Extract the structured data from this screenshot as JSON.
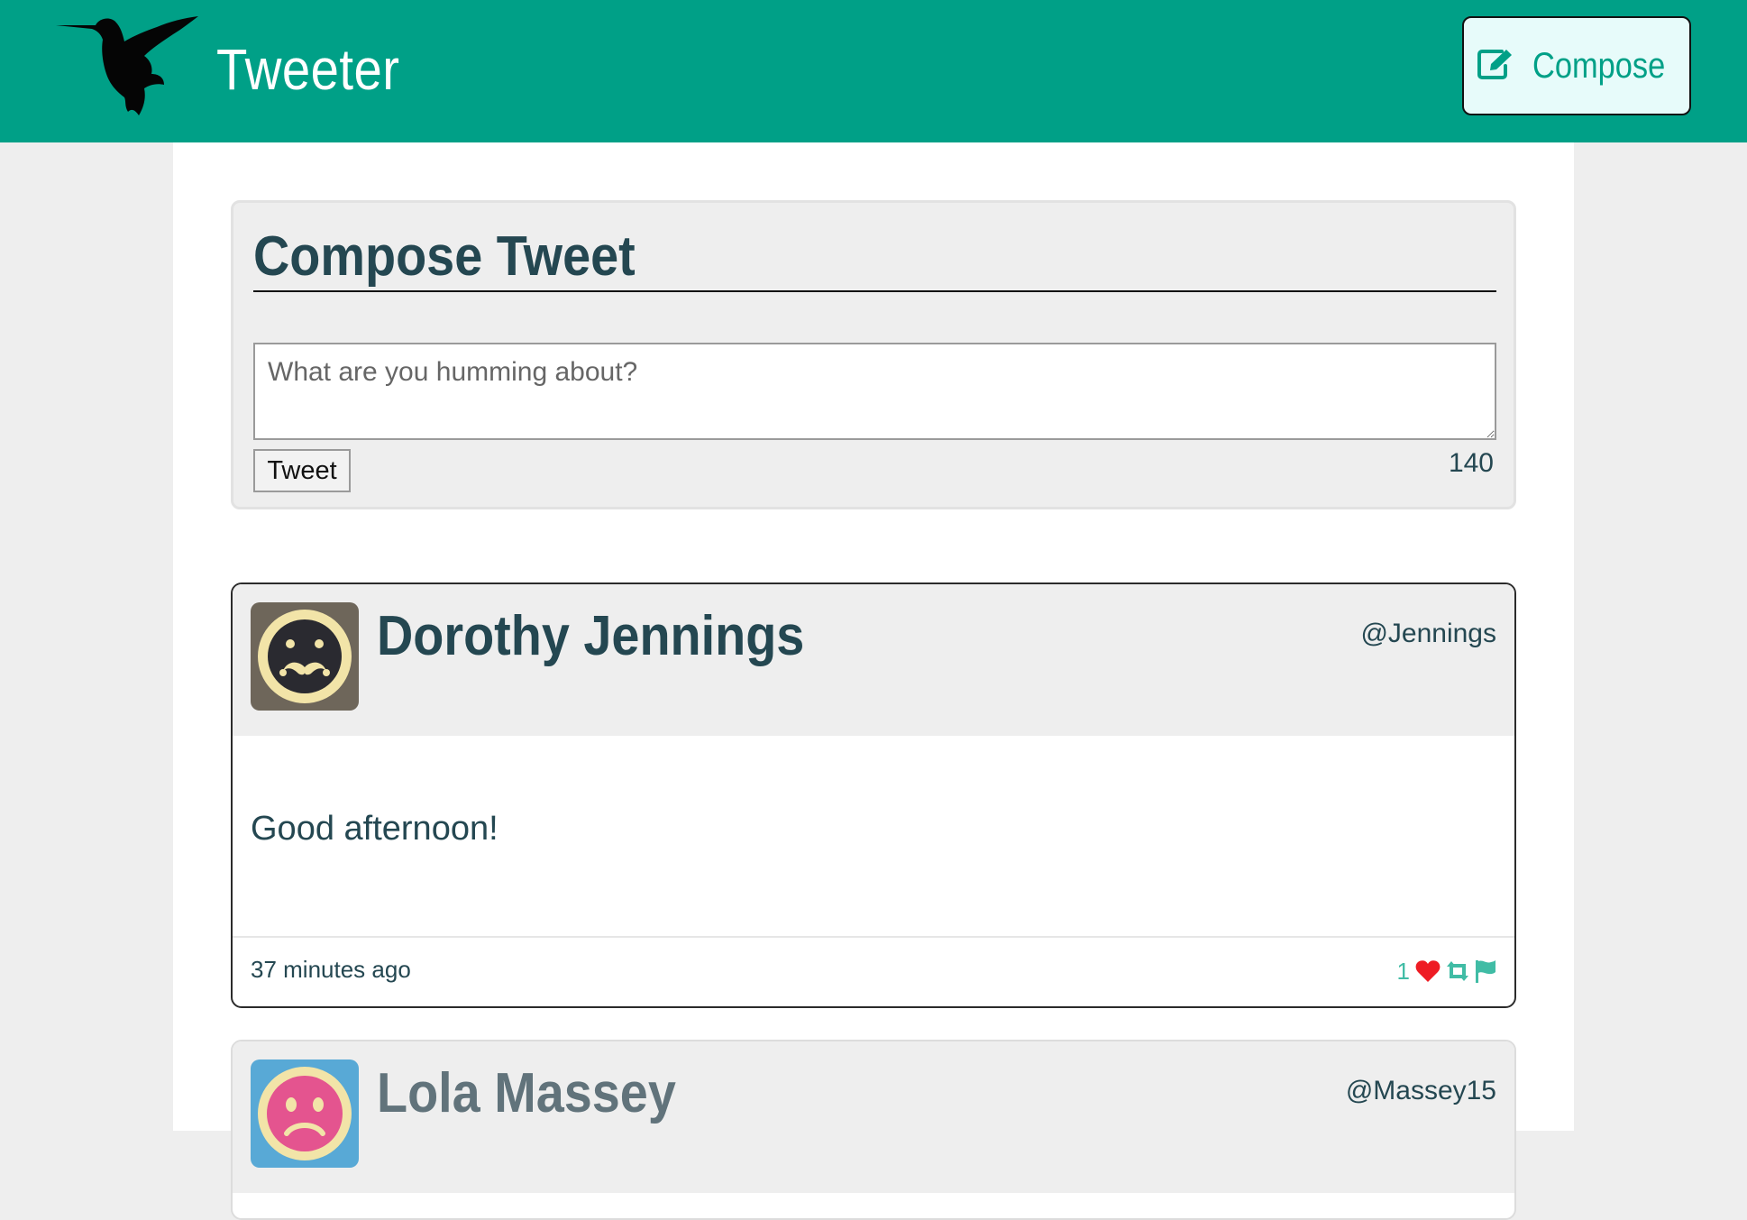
{
  "navbar": {
    "brand": "Tweeter",
    "compose_label": "Compose",
    "logo_icon": "hummingbird-icon",
    "compose_icon": "edit-icon"
  },
  "new_tweet": {
    "title": "Compose Tweet",
    "placeholder": "What are you humming about?",
    "submit_label": "Tweet",
    "counter": "140"
  },
  "tweets": [
    {
      "name": "Dorothy Jennings",
      "handle": "@Jennings",
      "content": "Good afternoon!",
      "timestamp": "37 minutes ago",
      "likes": "1",
      "avatar_icon": "mustache-face-icon",
      "avatar_bg": "#6e665a",
      "avatar_ring": "#f2e4a8"
    },
    {
      "name": "Lola Massey",
      "handle": "@Massey15",
      "avatar_icon": "frown-face-icon",
      "avatar_bg": "#58a9d6",
      "avatar_ring": "#f2e4a8"
    }
  ],
  "colors": {
    "brand": "#00a087",
    "text": "#244751",
    "like": "#ee1c24",
    "action": "#40bca5"
  }
}
